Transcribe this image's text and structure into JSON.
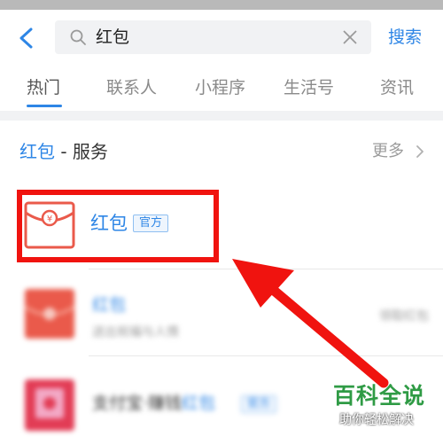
{
  "search": {
    "query": "红包",
    "submit_label": "搜索"
  },
  "tabs": [
    {
      "label": "热门",
      "active": true
    },
    {
      "label": "联系人",
      "active": false
    },
    {
      "label": "小程序",
      "active": false
    },
    {
      "label": "生活号",
      "active": false
    },
    {
      "label": "资讯",
      "active": false
    }
  ],
  "section": {
    "keyword": "红包",
    "suffix": " - 服务",
    "more_label": "更多"
  },
  "results": [
    {
      "title": "红包",
      "tag": "官方",
      "icon": "red-envelope-icon"
    },
    {
      "title": "红包",
      "subtitle": "送出祝福与人情",
      "side": "领取红包",
      "icon": "red-envelope-icon"
    },
    {
      "title": "支付宝·赚钱",
      "title_highlight": "红包",
      "tag": "官方",
      "icon": "red-envelope-icon"
    }
  ],
  "watermark": {
    "title": "百科全说",
    "subtitle": "助你轻松解决"
  },
  "colors": {
    "accent": "#2e86e6",
    "highlight": "#f0130f",
    "envelope": "#ea5a4b",
    "watermark": "#2f9b45"
  }
}
